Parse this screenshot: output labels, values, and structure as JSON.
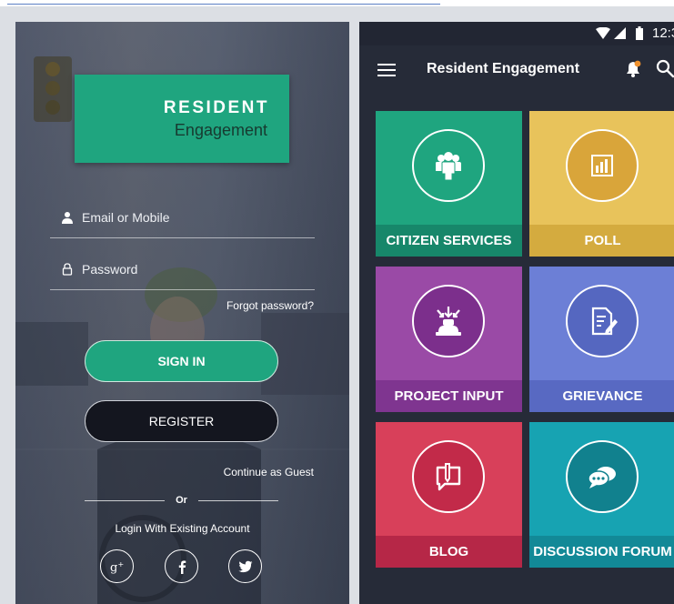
{
  "login": {
    "brand_title": "RESIDENT",
    "brand_subtitle": "Engagement",
    "email_placeholder": "Email or Mobile",
    "password_placeholder": "Password",
    "forgot_password": "Forgot password?",
    "sign_in": "SIGN IN",
    "register": "REGISTER",
    "continue_guest": "Continue as Guest",
    "or": "Or",
    "existing_account": "Login With Existing Account",
    "social": [
      "google-plus-icon",
      "facebook-icon",
      "twitter-icon"
    ]
  },
  "status_bar": {
    "time": "12:3"
  },
  "dashboard": {
    "title": "Resident Engagement",
    "tiles": [
      {
        "label": "CITIZEN SERVICES",
        "icon": "people-icon",
        "color": "#1fa57f"
      },
      {
        "label": "POLL",
        "icon": "bar-chart-icon",
        "color": "#e8c35b"
      },
      {
        "label": "PROJECT INPUT",
        "icon": "project-input-icon",
        "color": "#9a4aa6"
      },
      {
        "label": "GRIEVANCE",
        "icon": "document-edit-icon",
        "color": "#6c7fd6"
      },
      {
        "label": "BLOG",
        "icon": "blog-icon",
        "color": "#d8405a"
      },
      {
        "label": "DISCUSSION FORUM",
        "icon": "chat-bubbles-icon",
        "color": "#17a3b2"
      }
    ]
  },
  "colors": {
    "brand_green": "#1fa57f",
    "dark_bg": "#262b38",
    "notification_dot": "#f0922e"
  }
}
